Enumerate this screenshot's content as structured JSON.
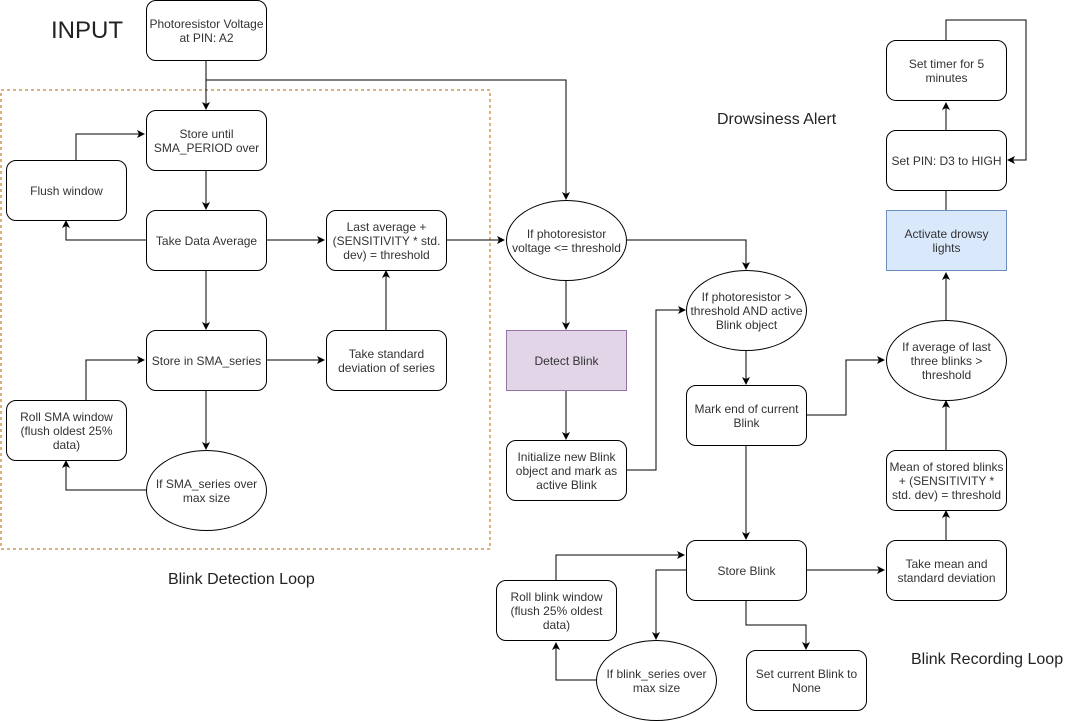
{
  "diagram": {
    "labels": {
      "input": "INPUT",
      "drowsiness_alert": "Drowsiness Alert",
      "blink_detection_loop": "Blink Detection Loop",
      "blink_recording_loop": "Blink Recording Loop"
    },
    "colors": {
      "stroke": "#000000",
      "group_border": "#b46504",
      "detect_fill": "#e1d5e7",
      "detect_stroke": "#9673a6",
      "alert_fill": "#dae8fc",
      "alert_stroke": "#6c8ebf"
    },
    "nodes": {
      "photoresistor": "Photoresistor Voltage at PIN: A2",
      "store_until": "Store until SMA_PERIOD over",
      "flush_window": "Flush window",
      "take_average": "Take Data Average",
      "last_average": "Last average + (SENSITIVITY * std. dev) = threshold",
      "store_sma": "Store in SMA_series",
      "take_std": "Take standard deviation of series",
      "roll_sma": "Roll SMA window (flush oldest 25% data)",
      "sma_over": "If SMA_series over max size",
      "if_le": "If photoresistor voltage <= threshold",
      "detect_blink": "Detect Blink",
      "init_blink": "Initialize new Blink object and mark as active Blink",
      "if_gt": "If photoresistor > threshold AND active Blink object",
      "mark_end": "Mark end of current Blink",
      "store_blink": "Store Blink",
      "roll_blink": "Roll blink window (flush 25% oldest data)",
      "blink_over": "If blink_series over max size",
      "set_none": "Set current Blink to None",
      "mean_std": "Take mean and standard deviation",
      "mean_threshold": "Mean of stored blinks + (SENSITIVITY * std. dev) = threshold",
      "avg_three": "If average of last three blinks > threshold",
      "activate_lights": "Activate drowsy lights",
      "set_pin": "Set PIN: D3 to HIGH",
      "set_timer": "Set timer for 5 minutes"
    }
  }
}
